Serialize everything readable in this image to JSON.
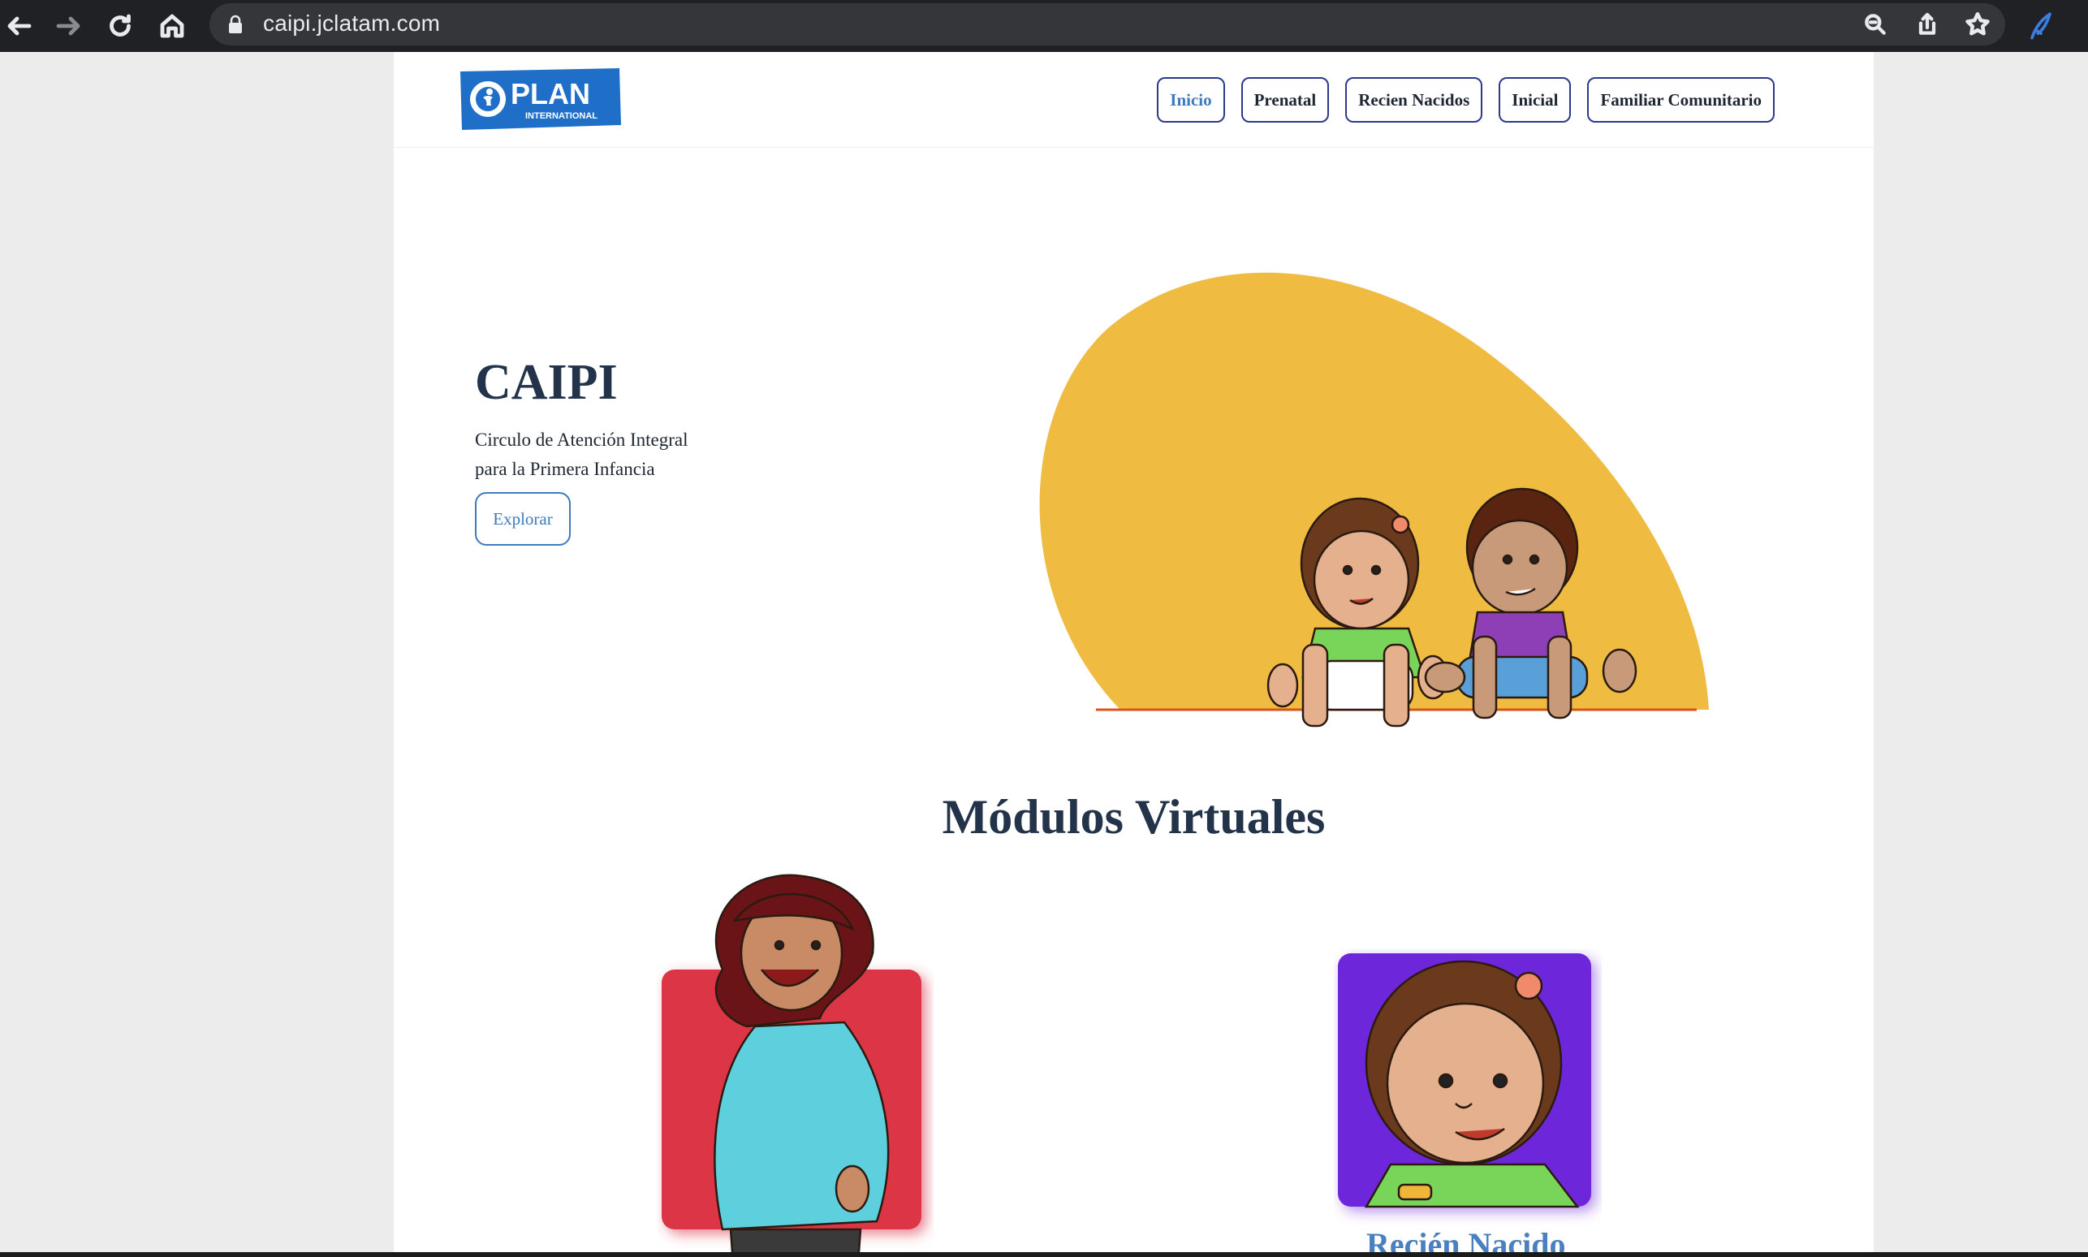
{
  "browser": {
    "url": "caipi.jclatam.com"
  },
  "header": {
    "logo": {
      "brand": "PLAN",
      "sub": "INTERNATIONAL"
    },
    "nav": [
      {
        "label": "Inicio",
        "active": true
      },
      {
        "label": "Prenatal",
        "active": false
      },
      {
        "label": "Recien Nacidos",
        "active": false
      },
      {
        "label": "Inicial",
        "active": false
      },
      {
        "label": "Familiar Comunitario",
        "active": false
      }
    ]
  },
  "hero": {
    "title": "CAIPI",
    "subtitle_line1": "Circulo de Atención Integral",
    "subtitle_line2": "para la Primera Infancia",
    "cta": "Explorar"
  },
  "modules": {
    "title": "Módulos Virtuales",
    "items": [
      {
        "label": "",
        "color": "#dc3545"
      },
      {
        "label": "Recién Nacido",
        "color": "#6d28d9"
      }
    ]
  },
  "colors": {
    "accent": "#3d7abf",
    "heading": "#22334a",
    "hero_blob": "#efbb40",
    "plan_blue": "#1f6fc9"
  }
}
